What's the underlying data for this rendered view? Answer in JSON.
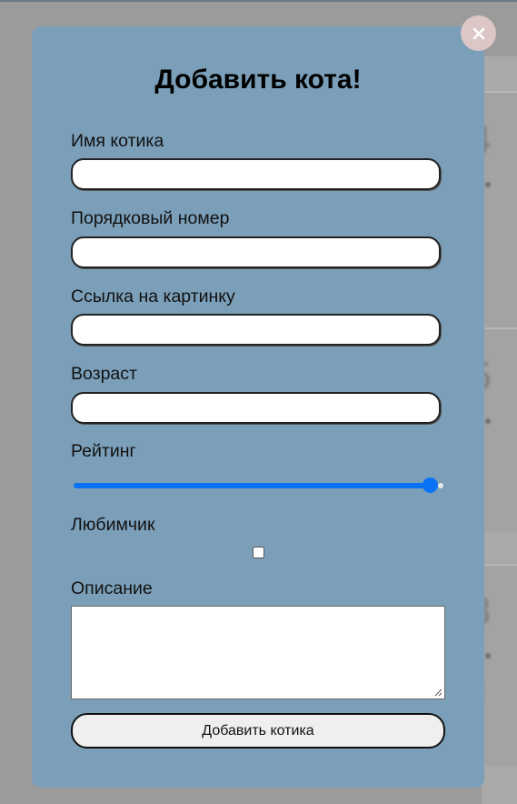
{
  "modal": {
    "title": "Добавить кота!",
    "close_icon": "close-icon",
    "fields": {
      "name_label": "Имя котика",
      "name_value": "",
      "number_label": "Порядковый номер",
      "number_value": "",
      "image_label": "Ссылка на картинку",
      "image_value": "",
      "age_label": "Возраст",
      "age_value": "",
      "rating_label": "Рейтинг",
      "rating_fraction": 1.0,
      "favorite_label": "Любимчик",
      "favorite_checked": false,
      "description_label": "Описание",
      "description_value": ""
    },
    "submit_label": "Добавить котика",
    "accent_color": "#0a73f5",
    "background_color": "#7b9fb9"
  },
  "background": {
    "cards": [
      {
        "number": "4"
      },
      {
        "number": "6"
      },
      {
        "number": "3"
      }
    ]
  }
}
